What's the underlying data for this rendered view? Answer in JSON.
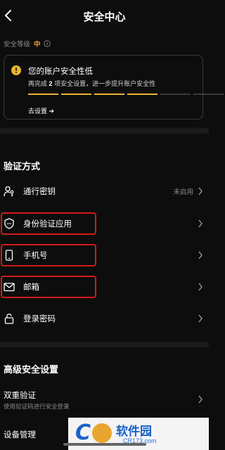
{
  "header": {
    "title": "安全中心",
    "back_icon": "chevron-left-icon"
  },
  "level": {
    "label": "安全等级",
    "value": "中",
    "value_color": "#e8a630"
  },
  "card": {
    "title": "您的账户安全性低",
    "desc_prefix": "再完成",
    "desc_count": "2",
    "desc_suffix": "项安全设置，进一步提升账户安全性",
    "progress_filled": 4,
    "progress_total": 6,
    "link_label": "去设置 ➔"
  },
  "verification": {
    "title": "验证方式",
    "items": [
      {
        "label": "通行密钥",
        "status": "未启用",
        "icon": "passkey-icon"
      },
      {
        "label": "身份验证应用",
        "status": "",
        "icon": "shield-icon"
      },
      {
        "label": "手机号",
        "status": "",
        "icon": "phone-icon"
      },
      {
        "label": "邮箱",
        "status": "",
        "icon": "mail-icon"
      },
      {
        "label": "登录密码",
        "status": "",
        "icon": "lock-icon"
      }
    ]
  },
  "advanced": {
    "title": "高级安全设置",
    "two_factor": {
      "label": "双重验证",
      "sub": "使用验证码进行安全登录"
    },
    "device_label": "设备管理"
  },
  "watermark": {
    "brand": "软件园",
    "url": "CR173.com"
  }
}
